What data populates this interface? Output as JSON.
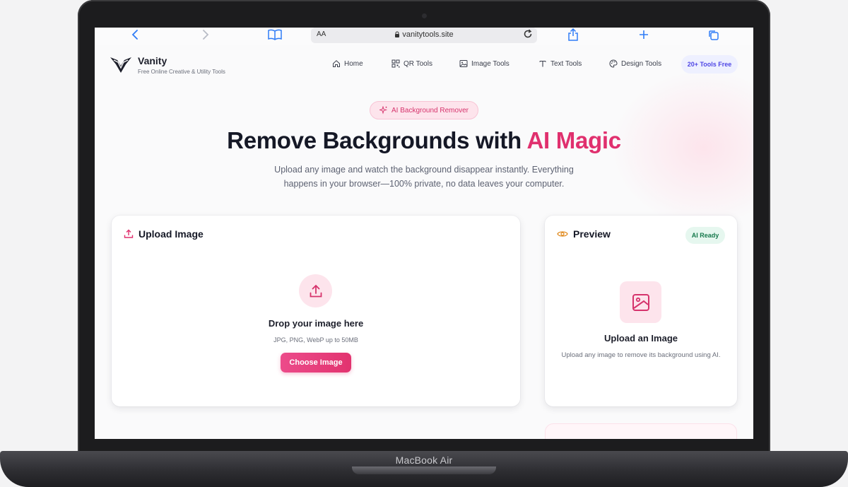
{
  "device": {
    "label": "MacBook Air"
  },
  "browser": {
    "text_size_label": "AA",
    "url": "vanitytools.site"
  },
  "site": {
    "brand": "Vanity",
    "tagline": "Free Online Creative & Utility Tools",
    "nav": [
      {
        "label": "Home",
        "icon": "home-icon"
      },
      {
        "label": "QR Tools",
        "icon": "qr-icon"
      },
      {
        "label": "Image Tools",
        "icon": "image-icon"
      },
      {
        "label": "Text Tools",
        "icon": "text-icon"
      },
      {
        "label": "Design Tools",
        "icon": "palette-icon"
      }
    ],
    "tools_badge": "20+ Tools Free"
  },
  "hero": {
    "badge": "AI Background Remover",
    "title_main": "Remove Backgrounds with ",
    "title_accent": "AI Magic",
    "subtitle": "Upload any image and watch the background disappear instantly. Everything happens in your browser—100% private, no data leaves your computer."
  },
  "upload": {
    "heading": "Upload Image",
    "drop_title": "Drop your image here",
    "drop_hint": "JPG, PNG, WebP up to 50MB",
    "button": "Choose Image"
  },
  "preview": {
    "heading": "Preview",
    "status": "AI Ready",
    "title": "Upload an Image",
    "description": "Upload any image to remove its background using AI."
  },
  "colors": {
    "accent": "#e0306e",
    "accent_soft": "#fde4ec",
    "indigo": "#4f46e5",
    "success": "#16794c",
    "text_dark": "#151826"
  }
}
